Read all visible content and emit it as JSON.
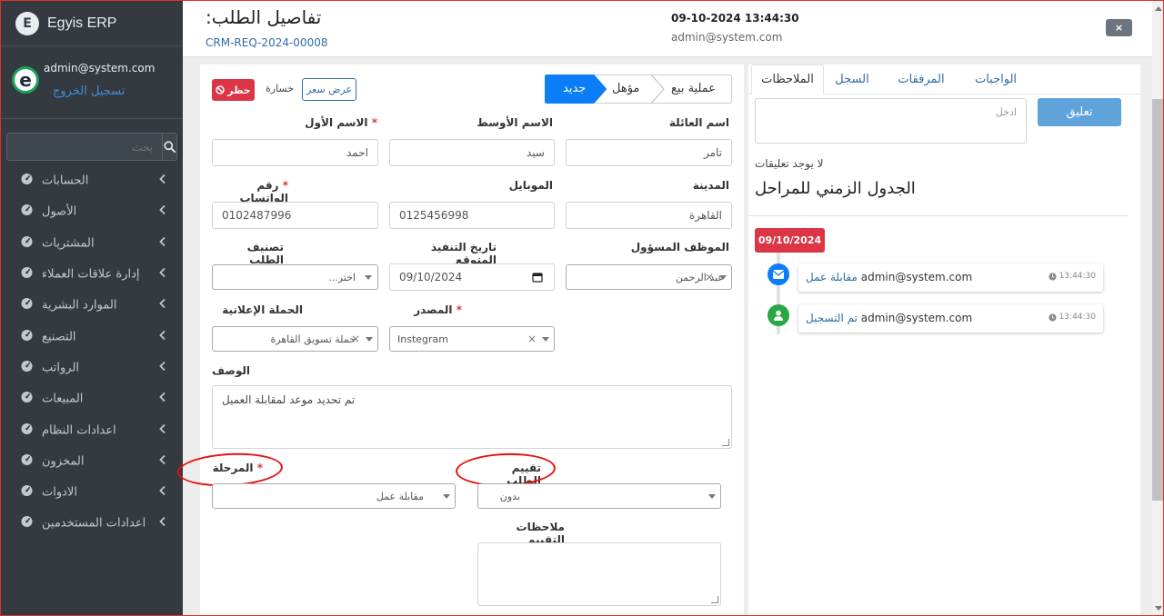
{
  "sidebar": {
    "brand": "Egyis ERP",
    "brand_logo": "E",
    "user_email": "admin@system.com",
    "logout": "تسجيل الخروج",
    "search_placeholder": "بحث",
    "items": [
      {
        "label": "الحسابات"
      },
      {
        "label": "الأصول"
      },
      {
        "label": "المشتريات"
      },
      {
        "label": "إدارة علاقات العملاء"
      },
      {
        "label": "الموارد البشرية"
      },
      {
        "label": "التصنيع"
      },
      {
        "label": "الرواتب"
      },
      {
        "label": "المبيعات"
      },
      {
        "label": "اعدادات النظام"
      },
      {
        "label": "المخزون"
      },
      {
        "label": "الادوات"
      },
      {
        "label": "اعدادات المستخدمين"
      }
    ]
  },
  "header": {
    "title": "تفاصيل الطلب:",
    "request_no": "CRM-REQ-2024-00008",
    "datetime": "09-10-2024 13:44:30",
    "user": "admin@system.com",
    "close": "×"
  },
  "actions": {
    "block": "حظر",
    "loss": "خسارة",
    "quote": "عرض سعر"
  },
  "stages": {
    "new": "جديد",
    "qualified": "مؤهل",
    "sale": "عملية بيع"
  },
  "form": {
    "first_name_label": "الاسم الأول",
    "first_name": "احمد",
    "middle_name_label": "الاسم الأوسط",
    "middle_name": "سيد",
    "family_name_label": "اسم العائلة",
    "family_name": "تامر",
    "whatsapp_label": "رقم الواتساب",
    "whatsapp": "0102487996",
    "mobile_label": "الموبايل",
    "mobile": "0125456998",
    "city_label": "المدينة",
    "city": "القاهرة",
    "classification_label": "تصنيف الطلب",
    "classification": "اختر...",
    "expected_date_label": "تاريخ التنفيذ المتوقع",
    "expected_date": "09/10/2024",
    "employee_label": "الموظف المسؤول",
    "employee": "عبد الرحمن",
    "campaign_label": "الحملة الإعلانية",
    "campaign": "حملة تسويق القاهرة",
    "source_label": "المصدر",
    "source": "Instegram",
    "description_label": "الوصف",
    "description": "تم تحديد موعد لمقابلة العميل",
    "stage_label": "المرحلة",
    "stage": "مقابلة عمل",
    "rating_label": "تقييم الطلب",
    "rating": "بدون",
    "rating_notes_label": "ملاحظات التقييم",
    "required_mark": "*"
  },
  "right": {
    "tabs": [
      "الملاحظات",
      "السجل",
      "المرفقات",
      "الواجبات"
    ],
    "comment_placeholder": "ادخل",
    "comment_button": "تعليق",
    "no_comments": "لا يوجد تعليقات",
    "timeline_title": "الجدول الزمني للمراحل",
    "date_badge": "09/10/2024",
    "events": [
      {
        "link": "مقابلة عمل",
        "user": "admin@system.com",
        "time": "13:44:30",
        "icon": "envelope-icon"
      },
      {
        "link": "تم التسجيل",
        "user": "admin@system.com",
        "time": "13:44:30",
        "icon": "user-icon"
      }
    ]
  },
  "colors": {
    "sidebar": "#343a40",
    "primary": "#007bff",
    "danger": "#dc3545",
    "annotation": "#e8100e"
  }
}
